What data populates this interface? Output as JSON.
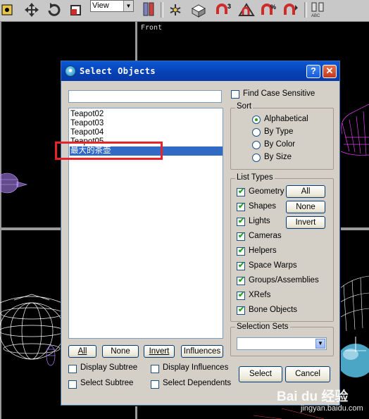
{
  "toolbar": {
    "view_combo": "View",
    "icons": [
      "select-icon",
      "move-icon",
      "rotate-icon",
      "scale-icon",
      "render-icon",
      "pivot-icon",
      "snap-3-icon",
      "angle-snap-icon",
      "percent-snap-icon",
      "spinner-snap-icon",
      "named-selection-icon",
      "mirror-icon"
    ],
    "snap_label": "3"
  },
  "viewport": {
    "label": "Front"
  },
  "dialog": {
    "title": "Select Objects",
    "filter_value": "",
    "objects": [
      "Teapot02",
      "Teapot03",
      "Teapot04",
      "Teapot05",
      "最大的茶壶"
    ],
    "selected_index": 4,
    "list_buttons": {
      "all": "All",
      "none": "None",
      "invert": "Invert",
      "influences": "Influences"
    },
    "checks": {
      "display_subtree": "Display Subtree",
      "display_influences": "Display Influences",
      "select_subtree": "Select Subtree",
      "select_dependents": "Select Dependents"
    },
    "find_case_sensitive": "Find Case Sensitive",
    "sort": {
      "title": "Sort",
      "options": [
        "Alphabetical",
        "By Type",
        "By Color",
        "By Size"
      ],
      "selected": "Alphabetical"
    },
    "list_types": {
      "title": "List Types",
      "items": [
        "Geometry",
        "Shapes",
        "Lights",
        "Cameras",
        "Helpers",
        "Space Warps",
        "Groups/Assemblies",
        "XRefs",
        "Bone Objects"
      ],
      "buttons": {
        "all": "All",
        "none": "None",
        "invert": "Invert"
      }
    },
    "selection_sets": {
      "title": "Selection Sets",
      "value": ""
    },
    "select_button": "Select",
    "cancel_button": "Cancel"
  },
  "watermark": {
    "logo": "Bai du 经验",
    "sub": "jingyan.baidu.com"
  },
  "colors": {
    "title_bar": "#0842b4",
    "selection": "#316ac5",
    "highlight_box": "#e8242a",
    "dialog_bg": "#d4d0c8"
  }
}
